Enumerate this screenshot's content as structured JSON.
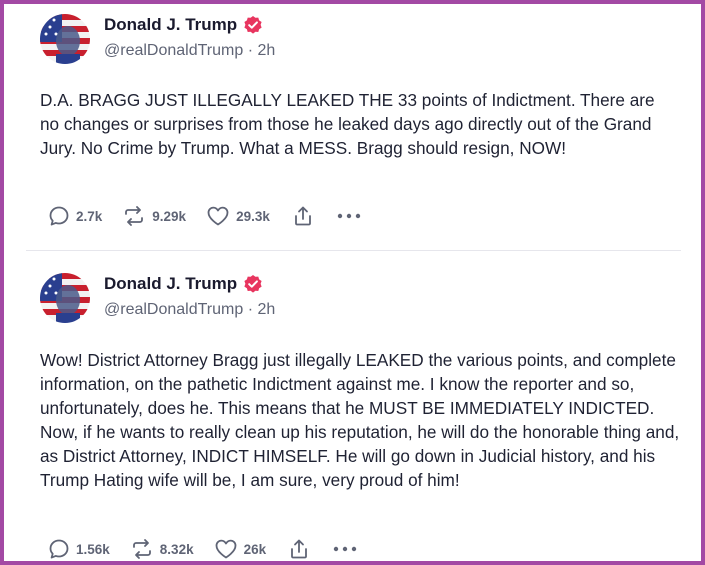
{
  "posts": [
    {
      "author": "Donald J. Trump",
      "handle": "@realDonaldTrump",
      "time": "2h",
      "text": "D.A. BRAGG JUST ILLEGALLY LEAKED THE 33 points of Indictment. There are no changes or surprises from those he leaked days ago directly out of the Grand Jury. No Crime by Trump. What a MESS. Bragg should resign, NOW!",
      "replies": "2.7k",
      "retruths": "9.29k",
      "likes": "29.3k"
    },
    {
      "author": "Donald J. Trump",
      "handle": "@realDonaldTrump",
      "time": "2h",
      "text": "Wow! District Attorney Bragg just illegally LEAKED the various points, and complete information, on the pathetic Indictment against me. I know the reporter and so, unfortunately, does he. This means that he MUST BE IMMEDIATELY INDICTED. Now, if he wants to really clean up his reputation, he will do the honorable thing and, as District Attorney, INDICT HIMSELF. He will go down in Judicial history, and his Trump Hating wife will be, I am sure, very proud of him!",
      "replies": "1.56k",
      "retruths": "8.32k",
      "likes": "26k"
    }
  ],
  "colors": {
    "frame": "#a349a4",
    "verified": "#e8355f",
    "text": "#1f2233",
    "muted": "#5f6475"
  },
  "icons": {
    "reply": "speech-bubble-icon",
    "retruth": "repost-arrows-icon",
    "like": "heart-icon",
    "share": "share-upload-icon",
    "more": "more-dots-icon",
    "verified": "verified-badge-icon"
  }
}
